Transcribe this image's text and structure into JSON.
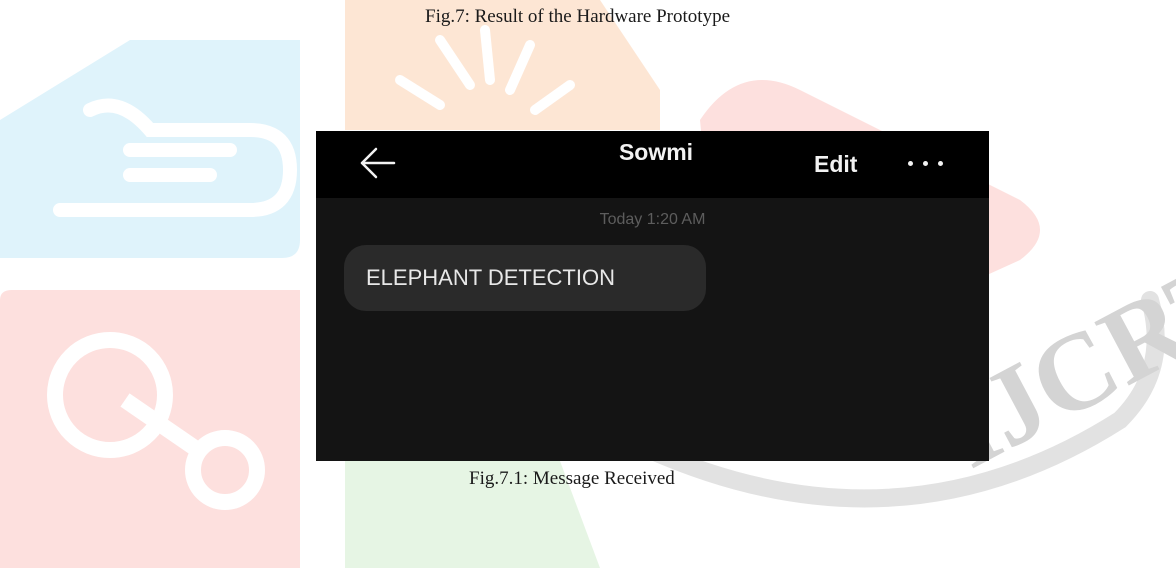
{
  "captions": {
    "top": "Fig.7: Result of the Hardware Prototype",
    "bottom": "Fig.7.1: Message Received"
  },
  "watermark": {
    "text": "IJCRT",
    "colors": [
      "#dff3fb",
      "#fde6d4",
      "#fde0de",
      "#e6f5e4",
      "#d6d6d6"
    ]
  },
  "message_screen": {
    "back_icon": "arrow-left-icon",
    "contact_name": "Sowmi",
    "edit_label": "Edit",
    "more_icon": "more-horizontal-icon",
    "timestamp": "Today 1:20 AM",
    "message_text": "ELEPHANT DETECTION",
    "colors": {
      "header_bg": "#000000",
      "body_bg": "#141414",
      "bubble_bg": "#2a2a2a",
      "text": "#f2f2f2"
    }
  }
}
